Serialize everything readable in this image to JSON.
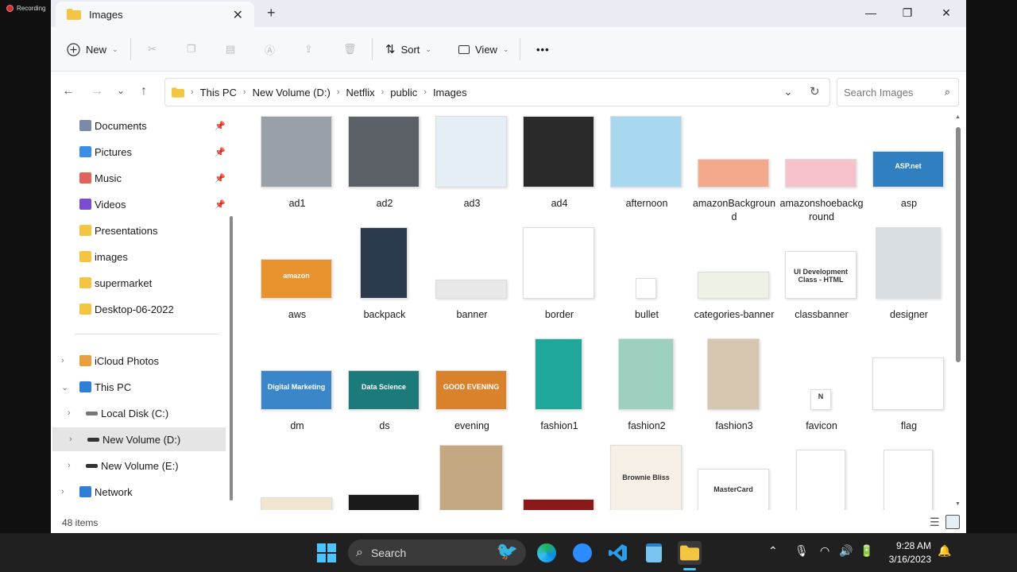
{
  "recording": {
    "label": "Recording"
  },
  "window": {
    "tab_title": "Images",
    "new_tab_glyph": "+",
    "close_tab_glyph": "✕",
    "minimize_glyph": "—",
    "maximize_glyph": "❐",
    "close_glyph": "✕"
  },
  "toolbar": {
    "new_label": "New",
    "sort_label": "Sort",
    "view_label": "View",
    "more_glyph": "•••"
  },
  "address": {
    "crumbs": [
      "This PC",
      "New Volume (D:)",
      "Netflix",
      "public",
      "Images"
    ],
    "search_placeholder": "Search Images"
  },
  "sidebar": {
    "quick": [
      {
        "label": "Documents",
        "icon": "documents-icon",
        "color": "#7a8aa8",
        "pinned": true
      },
      {
        "label": "Pictures",
        "icon": "pictures-icon",
        "color": "#3a8ee6",
        "pinned": true
      },
      {
        "label": "Music",
        "icon": "music-icon",
        "color": "#e0645a",
        "pinned": true
      },
      {
        "label": "Videos",
        "icon": "videos-icon",
        "color": "#7a4ccf",
        "pinned": true
      },
      {
        "label": "Presentations",
        "icon": "folder-icon",
        "color": "#f4c542",
        "pinned": false
      },
      {
        "label": "images",
        "icon": "folder-icon",
        "color": "#f4c542",
        "pinned": false
      },
      {
        "label": "supermarket",
        "icon": "folder-icon",
        "color": "#f4c542",
        "pinned": false
      },
      {
        "label": "Desktop-06-2022",
        "icon": "folder-icon",
        "color": "#f4c542",
        "pinned": false
      }
    ],
    "tree": [
      {
        "label": "iCloud Photos",
        "icon": "icloud-photos-icon",
        "color": "#e8a040",
        "expand": "›",
        "indent": 0
      },
      {
        "label": "This PC",
        "icon": "this-pc-icon",
        "color": "#2f7fd6",
        "expand": "⌄",
        "indent": 0
      },
      {
        "label": "Local Disk (C:)",
        "icon": "drive-icon",
        "color": "#777777",
        "expand": "›",
        "indent": 1
      },
      {
        "label": "New Volume (D:)",
        "icon": "drive-icon",
        "color": "#333333",
        "expand": "›",
        "indent": 1,
        "selected": true
      },
      {
        "label": "New Volume (E:)",
        "icon": "drive-icon",
        "color": "#333333",
        "expand": "›",
        "indent": 1
      },
      {
        "label": "Network",
        "icon": "network-icon",
        "color": "#2f7fd6",
        "expand": "›",
        "indent": 0
      }
    ]
  },
  "files": [
    {
      "name": "ad1",
      "bg": "#9aa0a8"
    },
    {
      "name": "ad2",
      "bg": "#5a6066"
    },
    {
      "name": "ad3",
      "bg": "#e6eef5"
    },
    {
      "name": "ad4",
      "bg": "#2a2a2a"
    },
    {
      "name": "afternoon",
      "bg": "#a8d8f0"
    },
    {
      "name": "amazonBackground",
      "bg": "#f3a98a"
    },
    {
      "name": "amazonshoebackground",
      "bg": "#f7c1cc"
    },
    {
      "name": "asp",
      "bg": "#2f7fc1",
      "text": "ASP.net"
    },
    {
      "name": "aws",
      "bg": "#e8932e",
      "text": "amazon"
    },
    {
      "name": "backpack",
      "bg": "#2c3a4e"
    },
    {
      "name": "banner",
      "bg": "#e8e8e8"
    },
    {
      "name": "border",
      "bg": "#ffffff"
    },
    {
      "name": "bullet",
      "bg": "#ffffff"
    },
    {
      "name": "categories-banner",
      "bg": "#eef2e6"
    },
    {
      "name": "classbanner",
      "bg": "#ffffff",
      "text": "UI Development Class - HTML"
    },
    {
      "name": "designer",
      "bg": "#d8dde2"
    },
    {
      "name": "dm",
      "bg": "#3a86c8",
      "text": "Digital Marketing"
    },
    {
      "name": "ds",
      "bg": "#1d7a7a",
      "text": "Data Science"
    },
    {
      "name": "evening",
      "bg": "#d9822b",
      "text": "GOOD EVENING"
    },
    {
      "name": "fashion1",
      "bg": "#1fa89a"
    },
    {
      "name": "fashion2",
      "bg": "#9ed0c0"
    },
    {
      "name": "fashion3",
      "bg": "#d6c6b0"
    },
    {
      "name": "favicon",
      "bg": "#ffffff",
      "text": "N"
    },
    {
      "name": "flag",
      "bg": "#ffffff"
    },
    {
      "name": "",
      "bg": "#f2e6d0"
    },
    {
      "name": "",
      "bg": "#1a1a1a"
    },
    {
      "name": "",
      "bg": "#c4a882"
    },
    {
      "name": "",
      "bg": "#8a1a1a"
    },
    {
      "name": "",
      "bg": "#f6efe6",
      "text": "Brownie Bliss"
    },
    {
      "name": "",
      "bg": "#ffffff",
      "text": "MasterCard"
    },
    {
      "name": "",
      "bg": "#ffffff"
    },
    {
      "name": "",
      "bg": "#ffffff"
    }
  ],
  "status": {
    "count": "48 items"
  },
  "taskbar": {
    "search_label": "Search",
    "time": "9:28 AM",
    "date": "3/16/2023"
  }
}
